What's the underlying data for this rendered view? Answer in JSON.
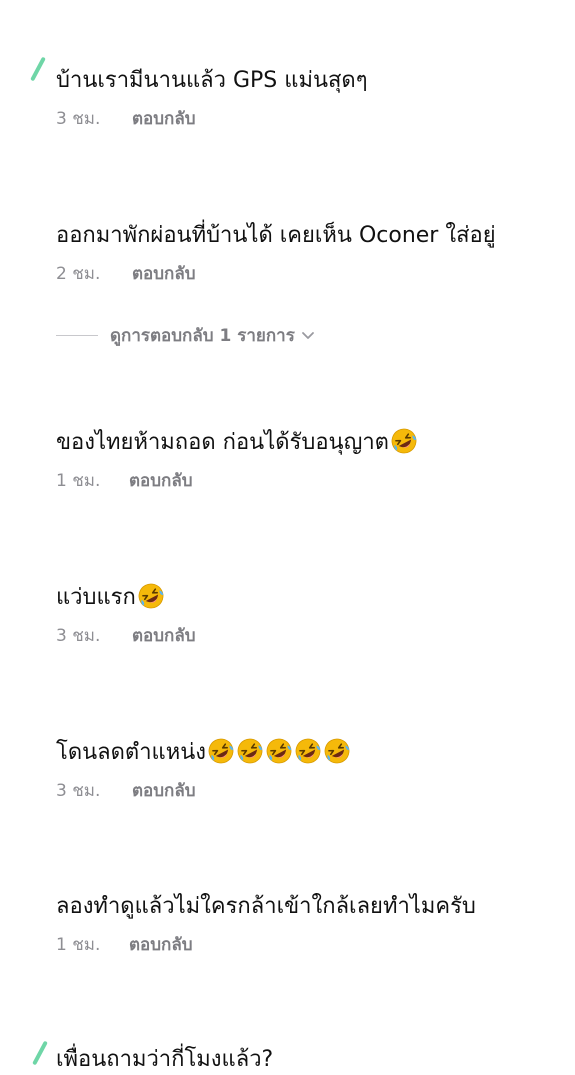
{
  "comments": [
    {
      "text": "บ้านเรามีนานแล้ว GPS แม่นสุดๆ",
      "time": "3 ชม.",
      "reply": "ตอบกลับ",
      "emoji_count": 0
    },
    {
      "text": "ออกมาพักผ่อนที่บ้านได้ เคยเห็น Oconer ใส่อยู่",
      "time": "2 ชม.",
      "reply": "ตอบกลับ",
      "emoji_count": 0
    },
    {
      "text": "ของไทยห้ามถอด ก่อนได้รับอนุญาต",
      "time": "1 ชม.",
      "reply": "ตอบกลับ",
      "emoji_count": 1
    },
    {
      "text": "แว่บแรก",
      "time": "3 ชม.",
      "reply": "ตอบกลับ",
      "emoji_count": 1
    },
    {
      "text": "โดนลดตำแหน่ง",
      "time": "3 ชม.",
      "reply": "ตอบกลับ",
      "emoji_count": 5
    },
    {
      "text": "ลองทำดูแล้วไม่ใครกล้าเข้าใกล้เลยทำไมครับ",
      "time": "1 ชม.",
      "reply": "ตอบกลับ",
      "emoji_count": 0
    },
    {
      "text": "เพื่อนถามว่ากี่โมงแล้ว?",
      "time": "",
      "reply": "",
      "emoji_count": 0
    }
  ],
  "view_replies": {
    "label": "ดูการตอบกลับ 1 รายการ"
  },
  "emoji": {
    "name": "rolling-on-floor-laughing-icon",
    "color": "#f5b90a"
  },
  "colors": {
    "text": "#111111",
    "meta": "#8e8e93",
    "accent_stroke": "#6fd6a7"
  }
}
